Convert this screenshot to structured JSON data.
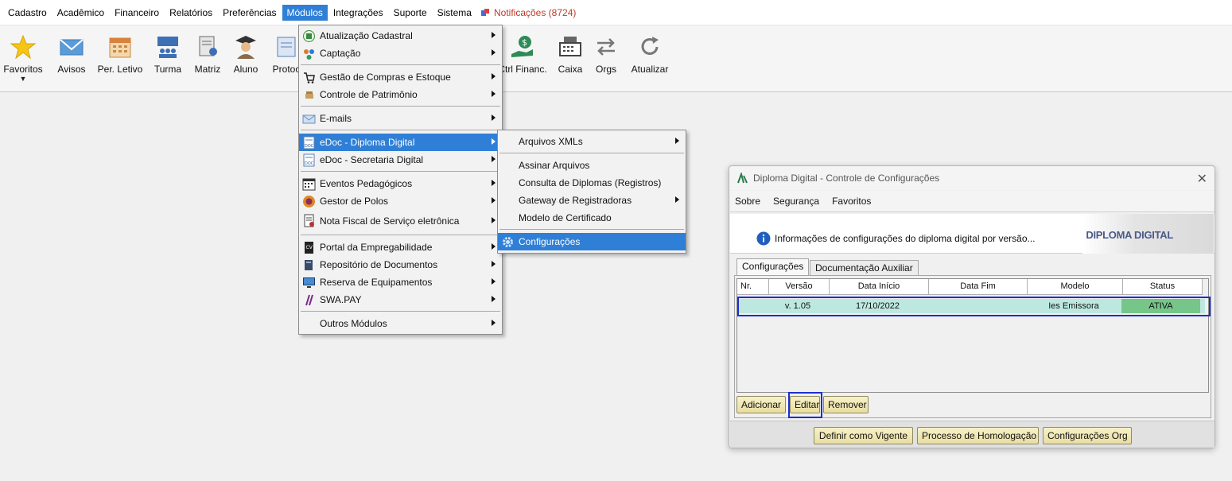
{
  "menubar": {
    "items": [
      "Cadastro",
      "Acadêmico",
      "Financeiro",
      "Relatórios",
      "Preferências",
      "Módulos",
      "Integrações",
      "Suporte",
      "Sistema"
    ],
    "notifications": "Notificações (8724)"
  },
  "toolbar": {
    "favoritos": "Favoritos",
    "avisos": "Avisos",
    "per_letivo": "Per. Letivo",
    "turma": "Turma",
    "matriz": "Matriz",
    "aluno": "Aluno",
    "protoc": "Protoc",
    "ctrl_financ": "Ctrl Financ.",
    "caixa": "Caixa",
    "orgs": "Orgs",
    "atualizar": "Atualizar"
  },
  "modulos_menu": {
    "items": [
      "Atualização Cadastral",
      "Captação",
      "Gestão de Compras e Estoque",
      "Controle de Patrimônio",
      "E-mails",
      "eDoc - Diploma Digital",
      "eDoc - Secretaria Digital",
      "Eventos Pedagógicos",
      "Gestor de Polos",
      "Nota Fiscal de Serviço eletrônica",
      "Portal da Empregabilidade",
      "Repositório de Documentos",
      "Reserva de Equipamentos",
      "SWA.PAY",
      "Outros Módulos"
    ]
  },
  "diploma_submenu": {
    "items": [
      "Arquivos XMLs",
      "Assinar Arquivos",
      "Consulta de Diplomas (Registros)",
      "Gateway de Registradoras",
      "Modelo de Certificado",
      "Configurações"
    ]
  },
  "dialog": {
    "title": "Diploma Digital - Controle de Configurações",
    "menu": [
      "Sobre",
      "Segurança",
      "Favoritos"
    ],
    "info_text": "Informações de configurações do diploma digital por versão...",
    "brand": "DIPLOMA DIGITAL",
    "tabs": [
      "Configurações",
      "Documentação Auxiliar"
    ],
    "columns": [
      "Nr.",
      "Versão",
      "Data Início",
      "Data Fim",
      "Modelo",
      "Status"
    ],
    "rows": [
      {
        "nr": "",
        "versao": "v. 1.05",
        "data_inicio": "17/10/2022",
        "data_fim": "",
        "modelo": "Ies Emissora",
        "status": "ATIVA"
      }
    ],
    "buttons": {
      "adicionar": "Adicionar",
      "editar": "Editar",
      "remover": "Remover"
    },
    "footer_buttons": {
      "definir": "Definir como Vigente",
      "processo": "Processo de Homologação",
      "config_org": "Configurações Org"
    }
  },
  "colors": {
    "menu_highlight": "#2f7fd6",
    "status_active": "#76c68a",
    "row_selected": "#bde8e0",
    "annotation_box": "#1b2fd0"
  }
}
